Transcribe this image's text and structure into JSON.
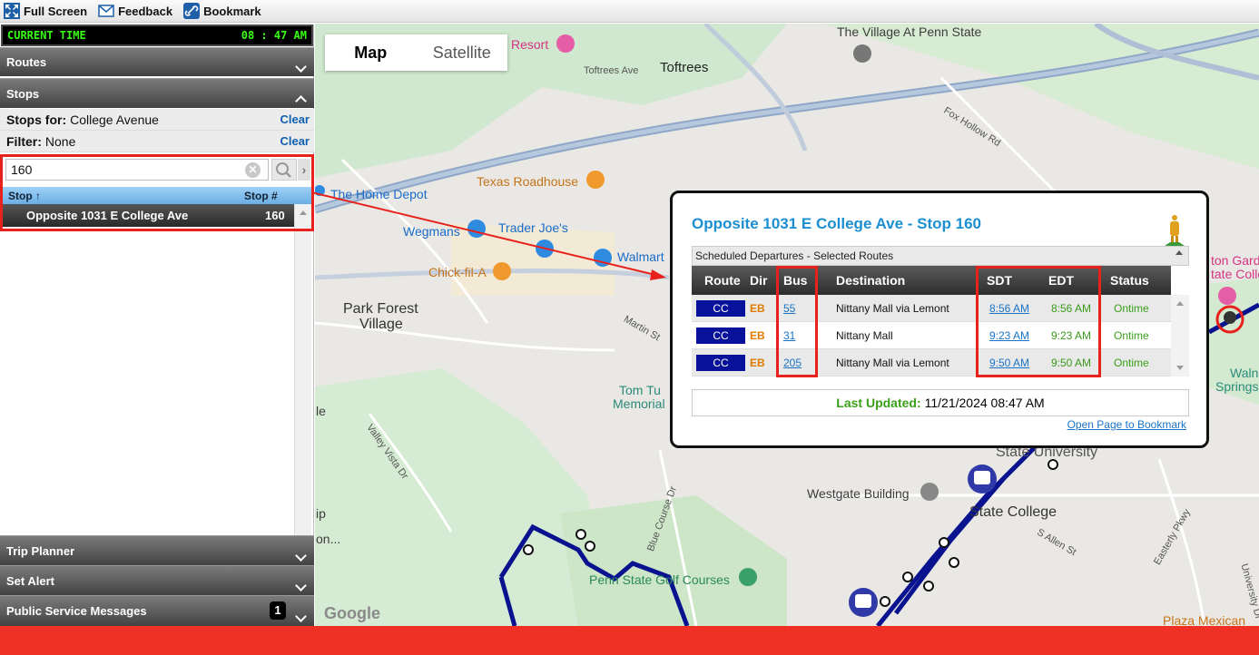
{
  "toolbar": {
    "fullscreen_label": "Full Screen",
    "feedback_label": "Feedback",
    "bookmark_label": "Bookmark"
  },
  "clock": {
    "label": "CURRENT TIME",
    "time": "08 : 47 AM"
  },
  "sections": {
    "routes": "Routes",
    "stops": "Stops",
    "trip_planner": "Trip Planner",
    "set_alert": "Set Alert",
    "psm": "Public Service Messages",
    "psm_count": "1"
  },
  "stops_panel": {
    "stops_for_label": "Stops for:",
    "stops_for_value": "College Avenue",
    "filter_label": "Filter:",
    "filter_value": "None",
    "clear_label": "Clear",
    "search_value": "160",
    "col_stop": "Stop ↑",
    "col_stop_num": "Stop #",
    "result_name": "Opposite 1031 E College Ave",
    "result_num": "160"
  },
  "map": {
    "map_tab": "Map",
    "satellite_tab": "Satellite",
    "labels": {
      "resort": "Resort",
      "village": "The Village At Penn State",
      "toftrees": "Toftrees",
      "toftrees_ave": "Toftrees Ave",
      "home_depot": "The Home Depot",
      "texas": "Texas Roadhouse",
      "trader": "Trader Joe's",
      "wegmans": "Wegmans",
      "walmart": "Walmart",
      "chickfila": "Chick-fil-A",
      "park_forest": "Park Forest",
      "park_forest2": "Village",
      "martin": "Martin St",
      "tom": "Tom Tu",
      "memorial": "Memorial",
      "fox_hollow": "Fox Hollow Rd",
      "valley": "Valley Vista Dr",
      "blue_course": "Blue Course Dr",
      "westgate": "Westgate Building",
      "state_college": "State College",
      "state_univ": "State University",
      "golf": "Penn State Golf Courses",
      "allen": "S Allen St",
      "easterly": "Easterly Pkwy",
      "university": "University Dr",
      "plaza": "Plaza Mexican",
      "garden": "ton Gard",
      "garden2": "tate Colle",
      "walnut": "Waln",
      "springs": "Springs",
      "google": "Google",
      "le": "le",
      "ip": "ip",
      "on": "on..."
    }
  },
  "popup": {
    "title": "Opposite 1031 E College Ave - Stop 160",
    "sched_header": "Scheduled Departures - Selected Routes",
    "columns": {
      "route": "Route",
      "dir": "Dir",
      "bus": "Bus",
      "destination": "Destination",
      "sdt": "SDT",
      "edt": "EDT",
      "status": "Status"
    },
    "rows": [
      {
        "route": "CC",
        "dir": "EB",
        "bus": "55",
        "destination": "Nittany Mall via Lemont",
        "sdt": "8:56 AM",
        "edt": "8:56 AM",
        "status": "Ontime"
      },
      {
        "route": "CC",
        "dir": "EB",
        "bus": "31",
        "destination": "Nittany Mall",
        "sdt": "9:23 AM",
        "edt": "9:23 AM",
        "status": "Ontime"
      },
      {
        "route": "CC",
        "dir": "EB",
        "bus": "205",
        "destination": "Nittany Mall via Lemont",
        "sdt": "9:50 AM",
        "edt": "9:50 AM",
        "status": "Ontime"
      }
    ],
    "last_updated_label": "Last Updated:",
    "last_updated_value": "11/21/2024 08:47 AM",
    "bookmark_link": "Open Page to Bookmark"
  },
  "colors": {
    "accent_red": "#e8211b",
    "route_blue": "#08119a",
    "title_blue": "#1b8fd1",
    "bottom_bar": "#ee3124"
  }
}
